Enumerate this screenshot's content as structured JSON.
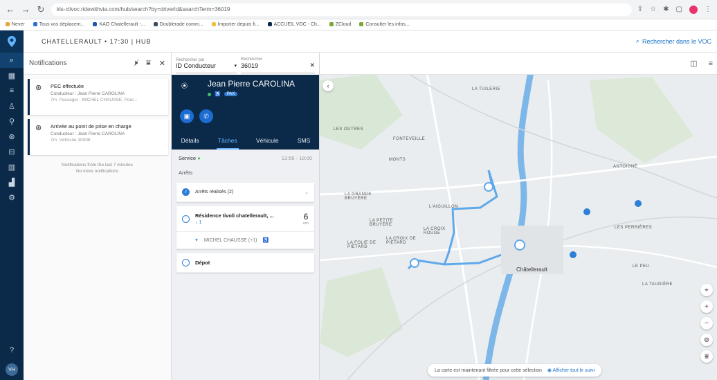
{
  "browser": {
    "url": "kls-ctlvoc.ridewithvia.com/hub/search?by=driverId&searchTerm=36019",
    "bookmarks": [
      "Never",
      "Tous vos déplacem...",
      "KAO Chatellerault -...",
      "Doublerade comm...",
      "Importer depuis fi...",
      "ACCUEIL VOC - Ch...",
      "ZCloud",
      "Consulter les infos..."
    ]
  },
  "topbar": {
    "context": "CHATELLERAULT • 17:30 | HUB",
    "search_voc": "Rechercher dans le VOC"
  },
  "notifications": {
    "title": "Notifications",
    "items": [
      {
        "title": "PEC effectuée",
        "line1": "Conducteur : Jean Pierre CAROLINA",
        "time": "7m",
        "line2": "Passager : MICHEL CHAUSSE, Pour..."
      },
      {
        "title": "Arrivée au point de prise en charge",
        "line1": "Conducteur : Jean Pierre CAROLINA",
        "time": "7m",
        "line2": "Véhicule 30006"
      }
    ],
    "footer_line1": "Notifications from the last 7 minutes",
    "footer_line2": "No more notifications"
  },
  "search": {
    "by_label": "Rechercher par",
    "by_value": "ID Conducteur",
    "term_label": "Rechercher",
    "term_value": "36019"
  },
  "driver": {
    "name": "Jean Pierre CAROLINA",
    "badge": "PAX",
    "tabs": [
      "Détails",
      "Tâches",
      "Véhicule",
      "SMS"
    ]
  },
  "service": {
    "label": "Service",
    "time": "12:56 - 18:00"
  },
  "stops": {
    "title": "Arrêts",
    "done": "Arrêts réalisés (2)",
    "current_name": "Résidence tivoli chatellerault, ...",
    "current_count": "1",
    "current_minutes": "6",
    "current_unit": "min",
    "passenger": "MICHEL CHAUSSE (+1)",
    "depot": "Dépot"
  },
  "map": {
    "filter_text": "La carte est maintenant filtrée pour cette sélection",
    "filter_link": "Afficher tout le suivi",
    "places": [
      "LA TUILERIE",
      "LES OUTRES",
      "FONTEVEILLE",
      "MONTS",
      "LA GRANDE BRUYÈRE",
      "LA PETITE BRUYÈRE",
      "LA CROIX ROUGE",
      "LA FOLIE DE PIÉTARD",
      "LA CROIX DE PIÉTARD",
      "ANTOIGNÉ",
      "LES PERRIÈRES",
      "LE PEU",
      "LA TAUDIÈRE",
      "Châtellerault",
      "L'AIGUILLON"
    ]
  },
  "colors": {
    "navy": "#0b2a4a",
    "accent": "#1d6cd2",
    "route": "#5fa8ea"
  }
}
